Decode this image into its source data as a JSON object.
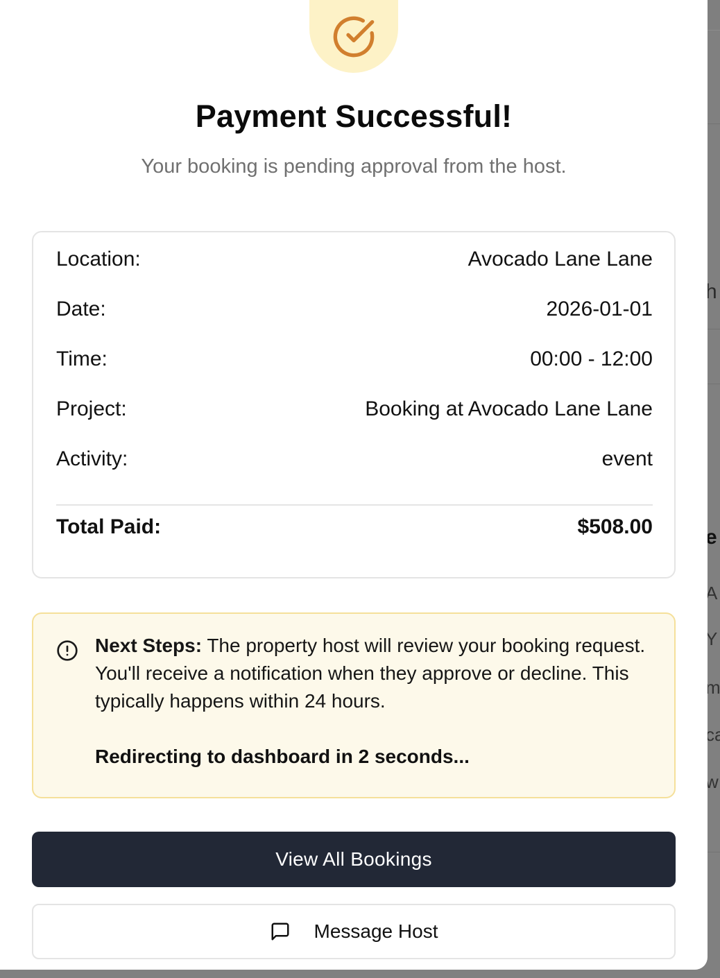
{
  "background": {
    "fragments": [
      "h",
      "e",
      "A",
      "Y",
      "m",
      "ca",
      "w"
    ]
  },
  "modal": {
    "success_icon": "check-circle-icon",
    "title": "Payment Successful!",
    "subtitle": "Your booking is pending approval from the host.",
    "details": [
      {
        "label": "Location:",
        "value": "Avocado Lane Lane"
      },
      {
        "label": "Date:",
        "value": "2026-01-01"
      },
      {
        "label": "Time:",
        "value": "00:00 - 12:00"
      },
      {
        "label": "Project:",
        "value": "Booking at Avocado Lane Lane"
      },
      {
        "label": "Activity:",
        "value": "event"
      }
    ],
    "total": {
      "label": "Total Paid:",
      "value": "$508.00"
    },
    "notice": {
      "icon": "info-circle-icon",
      "heading": "Next Steps:",
      "body": " The property host will review your booking request. You'll receive a notification when they approve or decline. This typically happens within 24 hours.",
      "redirect": "Redirecting to dashboard in 2 seconds..."
    },
    "primary_button": "View All Bookings",
    "secondary_button": {
      "icon": "message-square-icon",
      "label": "Message Host"
    }
  },
  "colors": {
    "accent_orange": "#d17f2e",
    "icon_circle_bg": "#fdf2c7",
    "primary_button_bg": "#222836",
    "notice_bg": "#fdf9ea",
    "notice_border": "#f5e09a",
    "overlay": "#808080"
  }
}
